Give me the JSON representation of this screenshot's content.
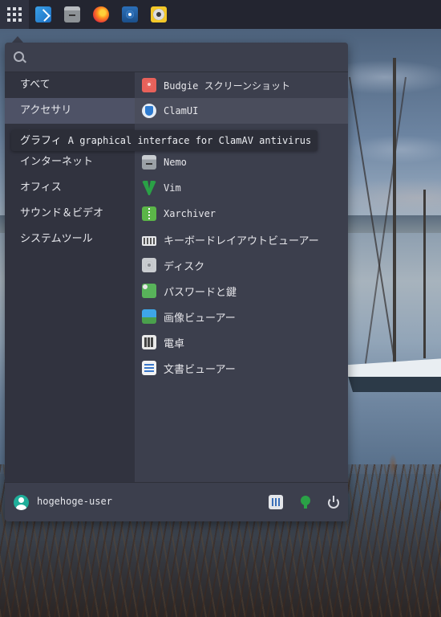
{
  "panel": {
    "taskbar_icons": [
      "app-grid-icon",
      "files-icon",
      "nemo-icon",
      "firefox-icon",
      "disk-icon",
      "rhythmbox-icon"
    ]
  },
  "search": {
    "placeholder": "",
    "value": ""
  },
  "categories": [
    {
      "label": "すべて",
      "selected": false
    },
    {
      "label": "アクセサリ",
      "selected": true
    },
    {
      "label": "グラフィ",
      "selected": false
    },
    {
      "label": "インターネット",
      "selected": false
    },
    {
      "label": "オフィス",
      "selected": false
    },
    {
      "label": "サウンド＆ビデオ",
      "selected": false
    },
    {
      "label": "システムツール",
      "selected": false
    }
  ],
  "apps": [
    {
      "label": "Budgie スクリーンショット",
      "icon": "camera-icon"
    },
    {
      "label": "ClamUI",
      "icon": "clamui-icon",
      "hover": true
    },
    {
      "label": "",
      "icon": "hidden-icon"
    },
    {
      "label": "Nemo",
      "icon": "nemo-icon"
    },
    {
      "label": "Vim",
      "icon": "vim-icon"
    },
    {
      "label": "Xarchiver",
      "icon": "archive-icon"
    },
    {
      "label": "キーボードレイアウトビューアー",
      "icon": "keyboard-icon"
    },
    {
      "label": "ディスク",
      "icon": "disk-icon"
    },
    {
      "label": "パスワードと鍵",
      "icon": "passwords-icon"
    },
    {
      "label": "画像ビューアー",
      "icon": "image-viewer-icon"
    },
    {
      "label": "電卓",
      "icon": "calculator-icon"
    },
    {
      "label": "文書ビューアー",
      "icon": "document-viewer-icon"
    }
  ],
  "tooltip": {
    "text": "A graphical interface for ClamAV antivirus"
  },
  "footer": {
    "username": "hogehoge-user",
    "buttons": [
      "settings-icon",
      "lock-icon",
      "power-icon"
    ]
  },
  "colors": {
    "panel_bg": "#232530",
    "menu_bg": "#3c3f4d",
    "sidebar_bg": "#31333f",
    "selected_bg": "#4e5266",
    "avatar": "#1fae9a"
  }
}
